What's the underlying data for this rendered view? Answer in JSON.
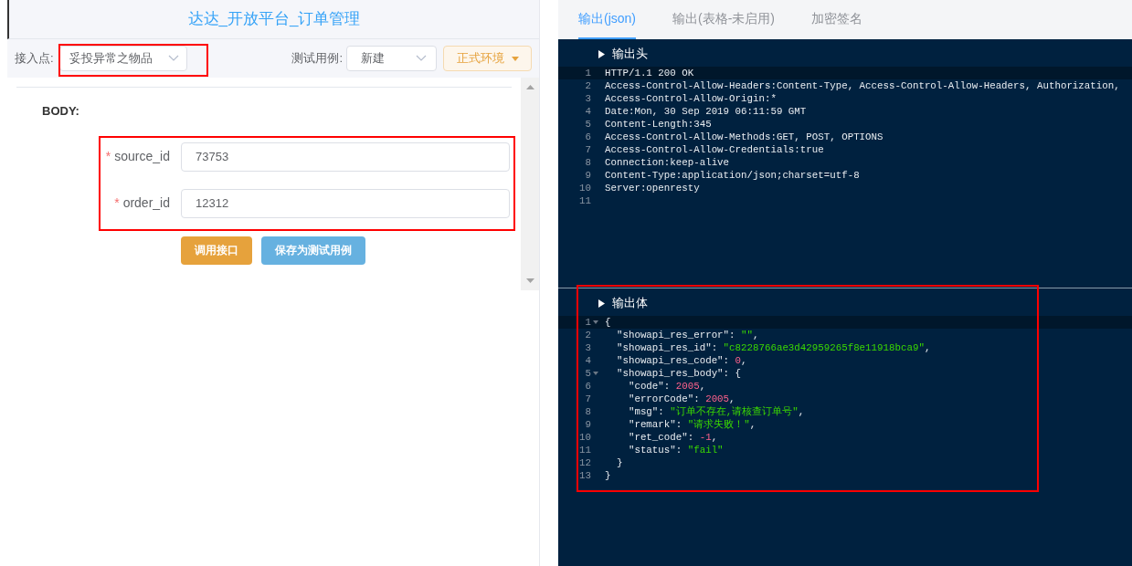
{
  "left_panel": {
    "title": "达达_开放平台_订单管理",
    "access_point": {
      "label": "接入点:",
      "value": "妥投异常之物品"
    },
    "test_case": {
      "label": "测试用例:",
      "value": "新建"
    },
    "environment": {
      "value": "正式环境"
    },
    "body_label": "BODY:",
    "fields": [
      {
        "label": "source_id",
        "required_mark": "*",
        "value": "73753"
      },
      {
        "label": "order_id",
        "required_mark": "*",
        "value": "12312"
      }
    ],
    "buttons": [
      {
        "label": "调用接口",
        "kind": "primary"
      },
      {
        "label": "保存为测试用例",
        "kind": "secondary"
      }
    ]
  },
  "right_panel": {
    "tabs": [
      {
        "label": "输出(json)",
        "selected": true
      },
      {
        "label": "输出(表格-未启用)",
        "selected": false
      },
      {
        "label": "加密签名",
        "selected": false
      }
    ],
    "header_section": {
      "title": "输出头",
      "lines": [
        {
          "number": "1",
          "fold": false,
          "tokens": [
            {
              "text": "HTTP/1.1 200 OK",
              "kind": "plain"
            }
          ]
        },
        {
          "number": "2",
          "fold": false,
          "tokens": [
            {
              "text": "Access-Control-Allow-Headers:Content-Type, Access-Control-Allow-Headers, Authorization,",
              "kind": "plain"
            }
          ]
        },
        {
          "number": "3",
          "fold": false,
          "tokens": [
            {
              "text": "Access-Control-Allow-Origin:*",
              "kind": "plain"
            }
          ]
        },
        {
          "number": "4",
          "fold": false,
          "tokens": [
            {
              "text": "Date:Mon, 30 Sep 2019 06:11:59 GMT",
              "kind": "plain"
            }
          ]
        },
        {
          "number": "5",
          "fold": false,
          "tokens": [
            {
              "text": "Content-Length:345",
              "kind": "plain"
            }
          ]
        },
        {
          "number": "6",
          "fold": false,
          "tokens": [
            {
              "text": "Access-Control-Allow-Methods:GET, POST, OPTIONS",
              "kind": "plain"
            }
          ]
        },
        {
          "number": "7",
          "fold": false,
          "tokens": [
            {
              "text": "Access-Control-Allow-Credentials:true",
              "kind": "plain"
            }
          ]
        },
        {
          "number": "8",
          "fold": false,
          "tokens": [
            {
              "text": "Connection:keep-alive",
              "kind": "plain"
            }
          ]
        },
        {
          "number": "9",
          "fold": false,
          "tokens": [
            {
              "text": "Content-Type:application/json;charset=utf-8",
              "kind": "plain"
            }
          ]
        },
        {
          "number": "10",
          "fold": false,
          "tokens": [
            {
              "text": "Server:openresty",
              "kind": "plain"
            }
          ]
        },
        {
          "number": "11",
          "fold": false
        }
      ]
    },
    "body_section": {
      "title": "输出体",
      "lines": [
        {
          "number": "1",
          "fold": true,
          "tokens": [
            {
              "text": "{",
              "kind": "plain"
            }
          ]
        },
        {
          "number": "2",
          "fold": false,
          "tokens": [
            {
              "text": "  \"showapi_res_error\": ",
              "kind": "plain"
            },
            {
              "text": "\"\"",
              "kind": "string"
            },
            {
              "text": ",",
              "kind": "plain"
            }
          ]
        },
        {
          "number": "3",
          "fold": false,
          "tokens": [
            {
              "text": "  \"showapi_res_id\": ",
              "kind": "plain"
            },
            {
              "text": "\"c8228766ae3d42959265f8e11918bca9\"",
              "kind": "string"
            },
            {
              "text": ",",
              "kind": "plain"
            }
          ]
        },
        {
          "number": "4",
          "fold": false,
          "tokens": [
            {
              "text": "  \"showapi_res_code\": ",
              "kind": "plain"
            },
            {
              "text": "0",
              "kind": "number"
            },
            {
              "text": ",",
              "kind": "plain"
            }
          ]
        },
        {
          "number": "5",
          "fold": true,
          "tokens": [
            {
              "text": "  \"showapi_res_body\": {",
              "kind": "plain"
            }
          ]
        },
        {
          "number": "6",
          "fold": false,
          "tokens": [
            {
              "text": "    \"code\": ",
              "kind": "plain"
            },
            {
              "text": "2005",
              "kind": "number"
            },
            {
              "text": ",",
              "kind": "plain"
            }
          ]
        },
        {
          "number": "7",
          "fold": false,
          "tokens": [
            {
              "text": "    \"errorCode\": ",
              "kind": "plain"
            },
            {
              "text": "2005",
              "kind": "number"
            },
            {
              "text": ",",
              "kind": "plain"
            }
          ]
        },
        {
          "number": "8",
          "fold": false,
          "tokens": [
            {
              "text": "    \"msg\": ",
              "kind": "plain"
            },
            {
              "text": "\"订单不存在,请核查订单号\"",
              "kind": "string"
            },
            {
              "text": ",",
              "kind": "plain"
            }
          ]
        },
        {
          "number": "9",
          "fold": false,
          "tokens": [
            {
              "text": "    \"remark\": ",
              "kind": "plain"
            },
            {
              "text": "\"请求失败！\"",
              "kind": "string"
            },
            {
              "text": ",",
              "kind": "plain"
            }
          ]
        },
        {
          "number": "10",
          "fold": false,
          "tokens": [
            {
              "text": "    \"ret_code\": ",
              "kind": "plain"
            },
            {
              "text": "-1",
              "kind": "number"
            },
            {
              "text": ",",
              "kind": "plain"
            }
          ]
        },
        {
          "number": "11",
          "fold": false,
          "tokens": [
            {
              "text": "    \"status\": ",
              "kind": "plain"
            },
            {
              "text": "\"fail\"",
              "kind": "string"
            }
          ]
        },
        {
          "number": "12",
          "fold": false,
          "tokens": [
            {
              "text": "  }",
              "kind": "plain"
            }
          ]
        },
        {
          "number": "13",
          "fold": false,
          "tokens": [
            {
              "text": "}",
              "kind": "plain"
            }
          ]
        }
      ]
    }
  }
}
